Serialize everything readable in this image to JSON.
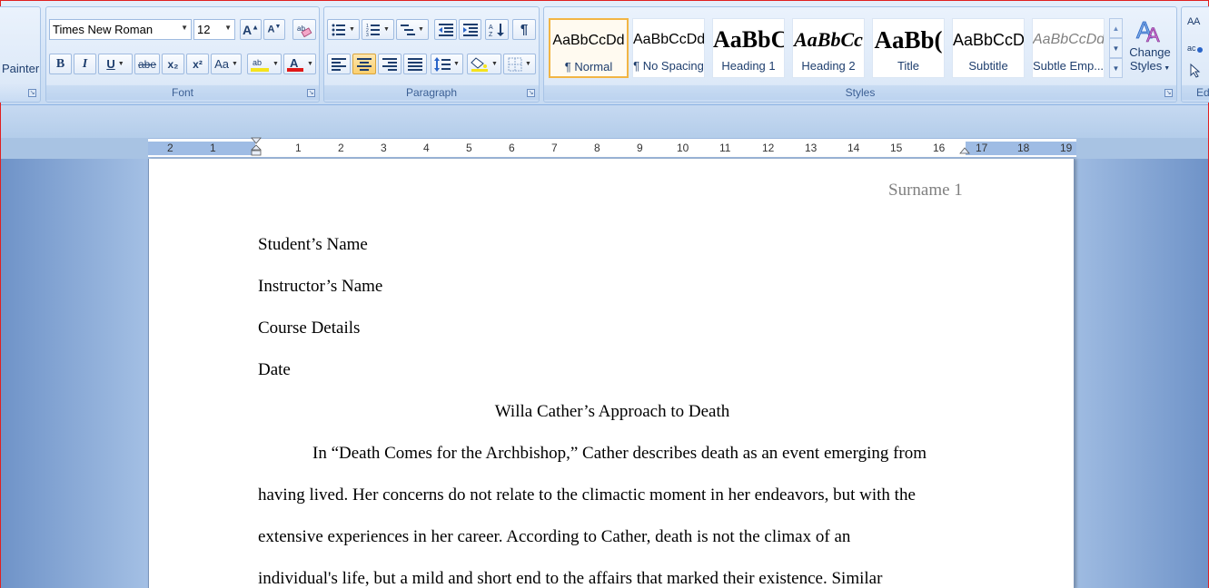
{
  "clipboard": {
    "painter_label": "Painter"
  },
  "font_group": {
    "label": "Font",
    "font_name": "Times New Roman",
    "font_size": "12",
    "bold": "B",
    "italic": "I",
    "underline": "U",
    "strike": "abe",
    "subscript": "x₂",
    "superscript": "x²",
    "change_case": "Aa"
  },
  "paragraph_group": {
    "label": "Paragraph",
    "pilcrow": "¶"
  },
  "styles_group": {
    "label": "Styles",
    "tiles": [
      {
        "sample": "AaBbCcDd",
        "name": "¶ Normal"
      },
      {
        "sample": "AaBbCcDd",
        "name": "¶ No Spacing"
      },
      {
        "sample": "AaBbC(",
        "name": "Heading 1"
      },
      {
        "sample": "AaBbCc",
        "name": "Heading 2"
      },
      {
        "sample": "AaBb(",
        "name": "Title"
      },
      {
        "sample": "AaBbCcD",
        "name": "Subtitle"
      },
      {
        "sample": "AaBbCcDd",
        "name": "Subtle Emp..."
      }
    ],
    "change_styles_line1": "Change",
    "change_styles_line2": "Styles"
  },
  "editing_group": {
    "label": "Ed"
  },
  "ruler": {
    "ticks": [
      "2",
      "1",
      "1",
      "2",
      "3",
      "4",
      "5",
      "6",
      "7",
      "8",
      "9",
      "10",
      "11",
      "12",
      "13",
      "14",
      "15",
      "16",
      "17",
      "18",
      "19"
    ]
  },
  "document": {
    "header": "Surname 1",
    "student": "Student’s Name",
    "instructor": "Instructor’s Name",
    "course": "Course Details",
    "date": "Date",
    "title": "Willa Cather’s Approach to Death",
    "para_lines": [
      "In “Death Comes for the Archbishop,” Cather describes death as an event emerging from",
      "having lived. Her concerns do not relate to the climactic moment in her endeavors, but with the",
      "extensive experiences in her career. According to Cather, death is not the climax of an",
      "individual's life, but a mild and short end to the affairs that marked their existence. Similar"
    ]
  },
  "colors": {
    "highlight": "#f5e31c",
    "font_color": "#e01818",
    "selected_style_border": "#f2b544",
    "accent": "#15428b"
  }
}
